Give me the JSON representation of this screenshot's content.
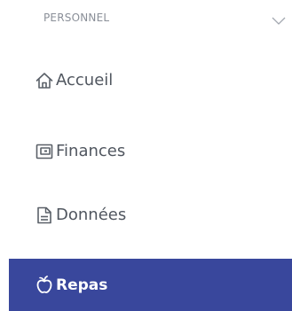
{
  "section": {
    "title": "PERSONNEL",
    "toggle_icon": "chevron-down-icon"
  },
  "nav": {
    "items": [
      {
        "label": "Accueil",
        "icon": "home-icon",
        "active": false
      },
      {
        "label": "Finances",
        "icon": "wallet-icon",
        "active": false
      },
      {
        "label": "Données",
        "icon": "document-icon",
        "active": false
      },
      {
        "label": "Repas",
        "icon": "apple-icon",
        "active": true
      }
    ]
  },
  "colors": {
    "active_background": "#39479c",
    "text": "#50565f",
    "header_text": "#8a8f98"
  }
}
